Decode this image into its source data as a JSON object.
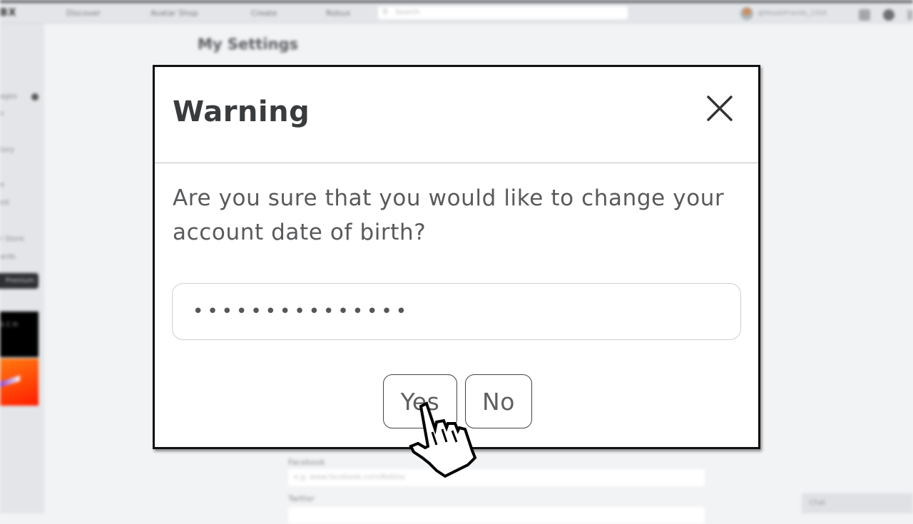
{
  "topnav": {
    "logo": "BX",
    "links": [
      "Discover",
      "Avatar Shop",
      "Create",
      "Robux"
    ],
    "search_placeholder": "Search",
    "username": "@HeadsFriends_1316",
    "user_menu_caret": "⌄"
  },
  "sidebar": {
    "items": [
      "",
      "",
      "ages",
      "s",
      "",
      "tory",
      "",
      "e",
      "ed",
      "",
      "r Store",
      "ards"
    ],
    "premium_label": "Premium",
    "ad_text": "S\nC\nH"
  },
  "page": {
    "title": "My Settings",
    "fields": [
      {
        "label": "Facebook",
        "placeholder": "e.g. www.facebook.com/Roblox"
      },
      {
        "label": "Twitter",
        "placeholder": ""
      }
    ],
    "chat_label": "Chat"
  },
  "modal": {
    "title": "Warning",
    "close_label": "×",
    "message": "Are you sure that you would like to change your account date of birth?",
    "password_value": "•••••••••••••••",
    "yes_label": "Yes",
    "no_label": "No"
  },
  "colors": {
    "modal_border": "#111111",
    "title_text": "#393b3d",
    "body_text": "#58595b",
    "page_bg": "#f2f3f5",
    "nav_bg": "#e3e5e8"
  }
}
